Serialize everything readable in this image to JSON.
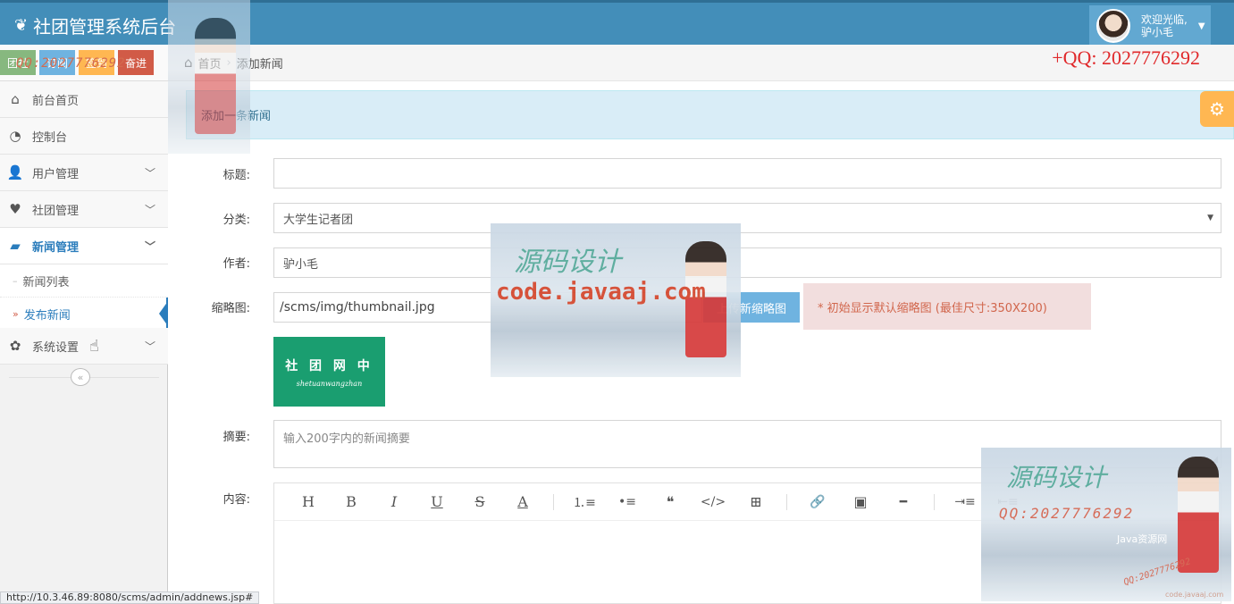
{
  "brand": {
    "title": "社团管理系统后台"
  },
  "user": {
    "greeting": "欢迎光临,",
    "name": "驴小毛"
  },
  "shortcuts": [
    "团社",
    "订阅",
    "签到",
    "奋进"
  ],
  "watermark_qq": "QQ:2027776292",
  "sidebar": {
    "items": [
      {
        "label": "前台首页",
        "icon": "home-icon"
      },
      {
        "label": "控制台",
        "icon": "dashboard-icon"
      },
      {
        "label": "用户管理",
        "icon": "user-icon"
      },
      {
        "label": "社团管理",
        "icon": "heart-icon"
      },
      {
        "label": "新闻管理",
        "icon": "book-icon"
      },
      {
        "label": "系统设置",
        "icon": "gear-icon"
      }
    ],
    "subitems": [
      {
        "label": "新闻列表"
      },
      {
        "label": "发布新闻"
      }
    ],
    "collapse_label": "«"
  },
  "breadcrumb": {
    "home": "首页",
    "current": "添加新闻"
  },
  "contact": "+QQ: 2027776292",
  "page_header": "添加一条新闻",
  "form": {
    "title_label": "标题:",
    "title_value": "",
    "category_label": "分类:",
    "category_value": "大学生记者团",
    "author_label": "作者:",
    "author_value": "驴小毛",
    "thumb_label": "缩略图:",
    "thumb_value": "/scms/img/thumbnail.jpg",
    "upload_button": "上传新缩略图",
    "thumb_hint": "* 初始显示默认缩略图 (最佳尺寸:350X200)",
    "thumb_image_text": "社 团 网 中",
    "thumb_image_sub": "shetuanwangzhan",
    "summary_label": "摘要:",
    "summary_placeholder": "输入200字内的新闻摘要",
    "content_label": "内容:"
  },
  "editor_toolbar": {
    "heading": "H",
    "bold": "B",
    "italic": "I",
    "underline": "U",
    "strike": "S",
    "color": "A",
    "ol": "⒈≡",
    "ul": "•≡",
    "quote": "❝",
    "code": "</>",
    "table": "⊞",
    "link": "🔗",
    "image": "▣",
    "hr": "━",
    "indent": "⇥≡",
    "outdent": "⇤≡"
  },
  "status_url": "http://10.3.46.89:8080/scms/admin/addnews.jsp#",
  "watermarks": {
    "calligraphy": "源码设计",
    "qq": "QQ:2027776292",
    "site": "code.javaaj.com",
    "java_site": "Java资源网",
    "small_qq": "QQ:2027776292",
    "footer_site": "code.javaaj.com"
  },
  "colors": {
    "navbar": "#438eb9",
    "accent": "#2b7dbc",
    "upload": "#6fb3e0",
    "hint_bg": "#f2dede",
    "warning": "#ffb752"
  }
}
